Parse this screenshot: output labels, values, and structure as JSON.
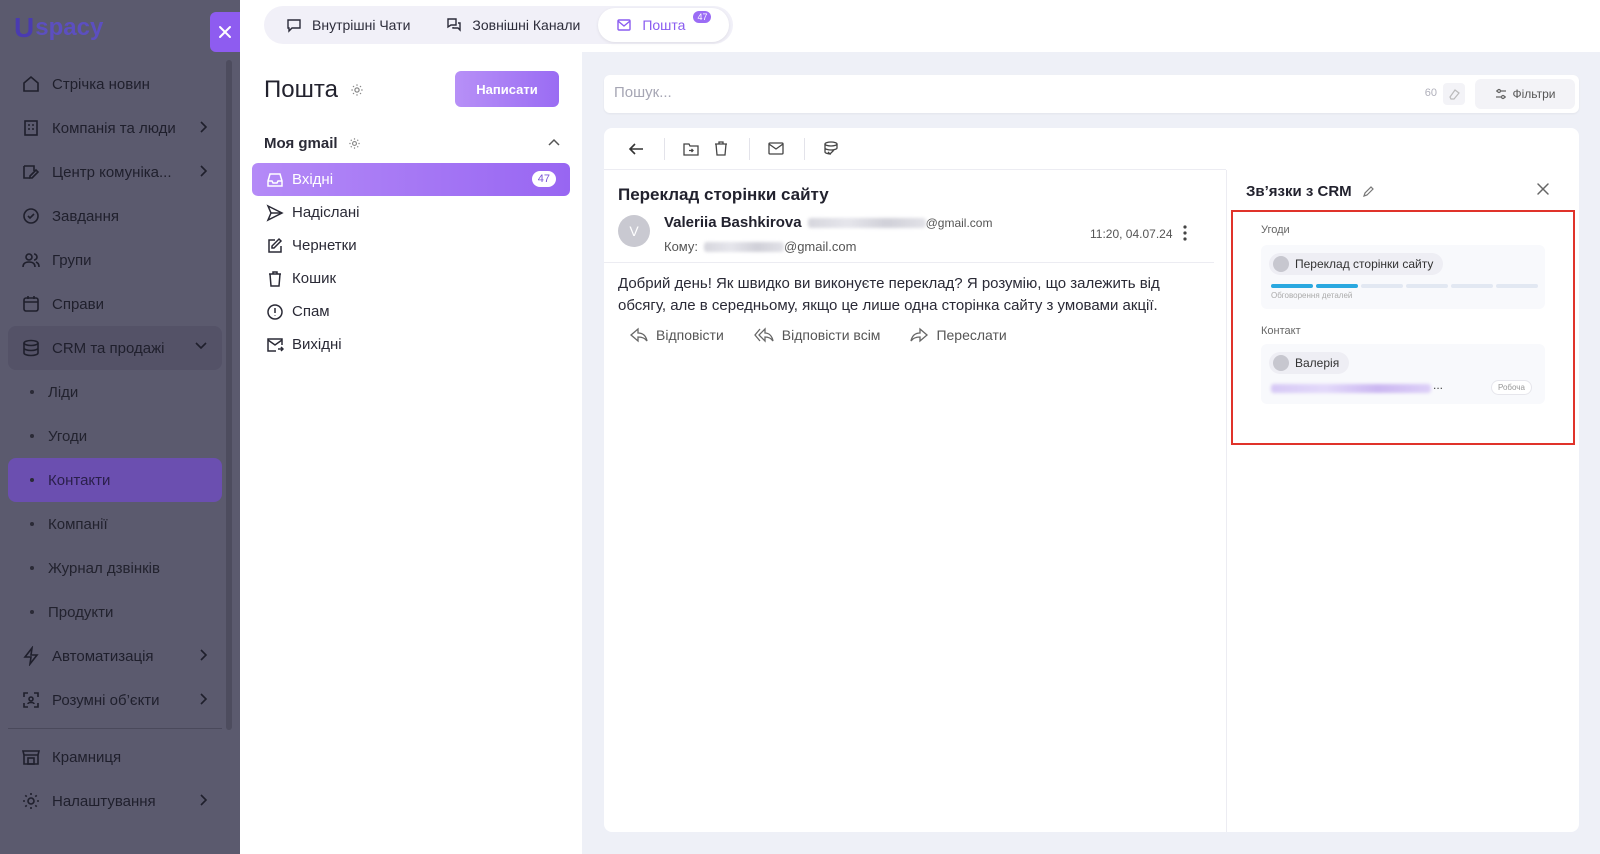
{
  "app": {
    "logo_u": "U",
    "logo_rest": "spacy"
  },
  "sidebar": {
    "items": [
      {
        "label": "Стрічка новин",
        "icon": "home-icon"
      },
      {
        "label": "Компанія та люди",
        "icon": "building-icon"
      },
      {
        "label": "Центр комуніка...",
        "icon": "chat-edit-icon"
      },
      {
        "label": "Завдання",
        "icon": "check-circle-icon"
      },
      {
        "label": "Групи",
        "icon": "users-icon"
      },
      {
        "label": "Справи",
        "icon": "calendar-icon"
      },
      {
        "label": "CRM та продажі",
        "icon": "database-icon"
      }
    ],
    "sub_items": [
      "Ліди",
      "Угоди",
      "Контакти",
      "Компанії",
      "Журнал дзвінків",
      "Продукти"
    ],
    "active_sub": "Контакти",
    "after": [
      {
        "label": "Автоматизація",
        "icon": "bolt-icon"
      },
      {
        "label": "Розумні об’єкти",
        "icon": "scan-icon"
      }
    ],
    "bottom": [
      {
        "label": "Крамниця",
        "icon": "store-icon"
      },
      {
        "label": "Налаштування",
        "icon": "gear-icon"
      }
    ]
  },
  "topbar": {
    "tabs": [
      {
        "label": "Внутрішні Чати"
      },
      {
        "label": "Зовнішні Канали"
      },
      {
        "label": "Пошта",
        "badge": "47"
      }
    ]
  },
  "mail": {
    "title": "Пошта",
    "write_button": "Написати",
    "account": "Моя gmail",
    "folders": [
      {
        "label": "Вхідні",
        "count": "47"
      },
      {
        "label": "Надіслані"
      },
      {
        "label": "Чернетки"
      },
      {
        "label": "Кошик"
      },
      {
        "label": "Спам"
      },
      {
        "label": "Вихідні"
      }
    ]
  },
  "search": {
    "placeholder": "Пошук...",
    "count": "60",
    "filters_label": "Фільтри"
  },
  "message": {
    "subject": "Переклад сторінки сайту",
    "avatar_letter": "V",
    "sender_name": "Valeriia Bashkirova",
    "sender_domain": "@gmail.com",
    "to_label": "Кому:",
    "to_domain": "@gmail.com",
    "time": "11:20, 04.07.24",
    "body": "Добрий день! Як швидко ви виконуєте переклад? Я розумію, що залежить від обсягу, але в середньому, якщо це лише одна сторінка сайту з умовами акції.",
    "actions": [
      "Відповісти",
      "Відповісти всім",
      "Переслати"
    ]
  },
  "crm": {
    "title": "Зв’язки з CRM",
    "deals_label": "Угоди",
    "deal_name": "Переклад сторінки сайту",
    "deal_stage": "Обговорення деталей",
    "deal_stages_done": 2,
    "deal_stages_total": 6,
    "contact_label": "Контакт",
    "contact_name": "Валерія",
    "contact_ellipsis": "...",
    "contact_tag": "Робоча",
    "highlight_color": "#e0332a"
  },
  "colors": {
    "accent": "#9a6cf3",
    "sidebar_dim": "#5b5a6e"
  }
}
